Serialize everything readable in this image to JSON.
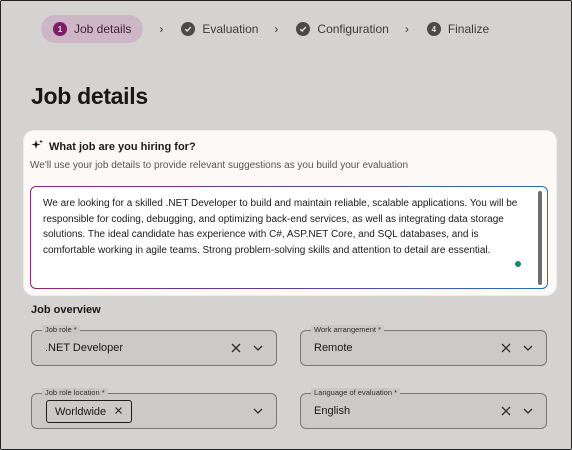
{
  "stepper": {
    "steps": [
      {
        "number": "1",
        "label": "Job details",
        "state": "active"
      },
      {
        "label": "Evaluation",
        "state": "completed"
      },
      {
        "label": "Configuration",
        "state": "completed"
      },
      {
        "number": "4",
        "label": "Finalize",
        "state": "pending"
      }
    ]
  },
  "page": {
    "title": "Job details"
  },
  "hiring_card": {
    "heading": "What job are you hiring for?",
    "subtext": "We'll use your job details to provide relevant suggestions as you build your evaluation",
    "description": "We are looking for a skilled .NET Developer to build and maintain reliable, scalable applications. You will be responsible for coding, debugging, and optimizing back-end services, as well as integrating data storage solutions. The ideal candidate has experience with C#, ASP.NET Core, and SQL databases, and is comfortable working in agile teams. Strong problem-solving skills and attention to detail are essential."
  },
  "job_overview": {
    "title": "Job overview",
    "job_role": {
      "label": "Job role *",
      "value": ".NET Developer"
    },
    "work_arrangement": {
      "label": "Work arrangement *",
      "value": "Remote"
    },
    "job_role_location": {
      "label": "Job role location *",
      "chip": "Worldwide"
    },
    "language": {
      "label": "Language of evaluation *",
      "value": "English"
    }
  },
  "colors": {
    "accent": "#8e2474",
    "active_step_bg": "#ead1e3",
    "status_dot": "#1b8a6b"
  }
}
